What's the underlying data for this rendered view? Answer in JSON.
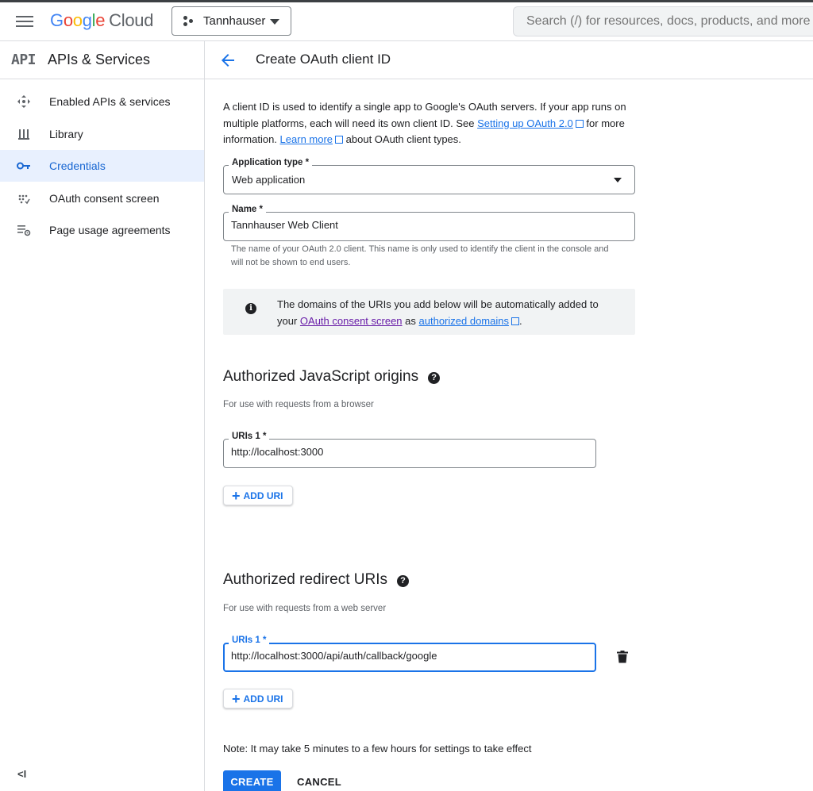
{
  "topbar": {
    "logo_letters": [
      "G",
      "o",
      "o",
      "g",
      "l",
      "e"
    ],
    "logo_product": "Cloud",
    "project_name": "Tannhauser",
    "search_placeholder": "Search (/) for resources, docs, products, and more"
  },
  "sidebar": {
    "logo_text": "API",
    "title": "APIs & Services",
    "items": [
      {
        "label": "Enabled APIs & services",
        "icon": "enabled-apis-icon",
        "active": false
      },
      {
        "label": "Library",
        "icon": "library-icon",
        "active": false
      },
      {
        "label": "Credentials",
        "icon": "key-icon",
        "active": true
      },
      {
        "label": "OAuth consent screen",
        "icon": "consent-icon",
        "active": false
      },
      {
        "label": "Page usage agreements",
        "icon": "settings-list-icon",
        "active": false
      }
    ],
    "collapse_label": "<I"
  },
  "header": {
    "title": "Create OAuth client ID"
  },
  "intro": {
    "part1": "A client ID is used to identify a single app to Google's OAuth servers. If your app runs on multiple platforms, each will need its own client ID. See ",
    "link1": "Setting up OAuth 2.0",
    "part2": " for more information. ",
    "link2": "Learn more",
    "part3": " about OAuth client types."
  },
  "form": {
    "app_type_label": "Application type *",
    "app_type_value": "Web application",
    "name_label": "Name *",
    "name_value": "Tannhauser Web Client",
    "name_helper": "The name of your OAuth 2.0 client. This name is only used to identify the client in the console and will not be shown to end users."
  },
  "info": {
    "part1": "The domains of the URIs you add below will be automatically added to your ",
    "link1": "OAuth consent screen",
    "part2": " as ",
    "link2": "authorized domains",
    "part3": "."
  },
  "js_origins": {
    "title": "Authorized JavaScript origins",
    "subtitle": "For use with requests from a browser",
    "uri_label": "URIs 1 *",
    "uri_value": "http://localhost:3000",
    "add_label": "ADD URI"
  },
  "redirects": {
    "title": "Authorized redirect URIs",
    "subtitle": "For use with requests from a web server",
    "uri_label": "URIs 1 *",
    "uri_value": "http://localhost:3000/api/auth/callback/google",
    "add_label": "ADD URI"
  },
  "footer": {
    "note": "Note: It may take 5 minutes to a few hours for settings to take effect",
    "create_label": "CREATE",
    "cancel_label": "CANCEL"
  },
  "colors": {
    "accent": "#1a73e8",
    "active_bg": "#e8f0fe",
    "visited_link": "#681da8"
  }
}
